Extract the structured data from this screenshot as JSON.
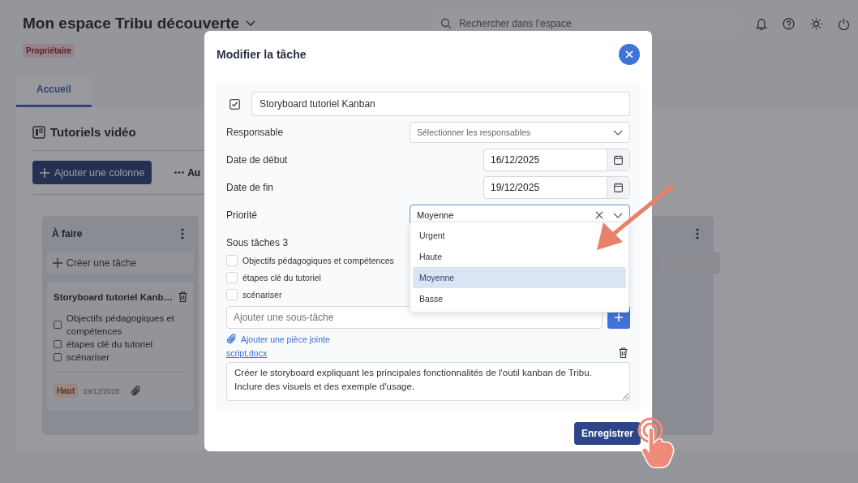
{
  "header": {
    "title": "Mon espace Tribu découverte",
    "role_badge": "Propriétaire",
    "search": {
      "placeholder": "Rechercher dans l’espace"
    }
  },
  "tabs": [
    {
      "label": "Accueil",
      "selected": true
    }
  ],
  "board": {
    "title": "Tutoriels vidéo",
    "add_column_button": "Ajouter une colonne",
    "more_button": "Au",
    "columns": [
      {
        "title": "À faire",
        "create_task": "Créer une tâche",
        "cards": [
          {
            "title": "Storyboard tutoriel Kanb…",
            "subtasks": [
              {
                "label": "Objectifs pédagogiques et compétences",
                "checked": false
              },
              {
                "label": "étapes clé du tutoriel",
                "checked": false
              },
              {
                "label": "scénariser",
                "checked": false
              }
            ],
            "priority": "Haut",
            "due_date": "19/12/2025",
            "has_attachment": true
          }
        ]
      }
    ]
  },
  "modal": {
    "title": "Modifier la tâche",
    "task_name": "Storyboard tutoriel Kanban",
    "fields": [
      {
        "kind": "select",
        "label": "Responsable",
        "placeholder": "Sélectionner les responsables"
      },
      {
        "kind": "date",
        "label": "Date de début",
        "value": "16/12/2025"
      },
      {
        "kind": "date",
        "label": "Date de fin",
        "value": "19/12/2025"
      },
      {
        "kind": "select",
        "label": "Priorité",
        "value": "Moyenne",
        "open": true,
        "clearable": true
      }
    ],
    "priority_options": [
      {
        "label": "Urgent",
        "selected": false
      },
      {
        "label": "Haute",
        "selected": false
      },
      {
        "label": "Moyenne",
        "selected": true
      },
      {
        "label": "Basse",
        "selected": false
      }
    ],
    "subtasks_label": "Sous tâches 3",
    "subtasks": [
      {
        "label": "Objectifs pédagogiques et compétences",
        "checked": false
      },
      {
        "label": "étapes clé du tutoriel",
        "checked": false
      },
      {
        "label": "scénariser",
        "checked": false
      }
    ],
    "new_subtask": {
      "placeholder": "Ajouter une sous-tâche"
    },
    "add_attachment": "Ajouter une pièce jointe",
    "attachment": "script.docx",
    "description": "Créer le storyboard expliquant les principales fonctionnalités de l'outil kanban de Tribu. Inclure des visuels et des exemple d'usage.",
    "save_button": "Enregistrer"
  }
}
